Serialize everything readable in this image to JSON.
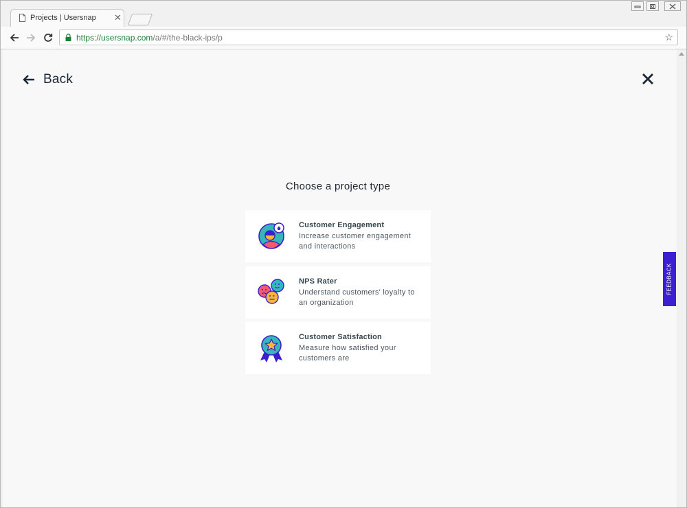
{
  "browser": {
    "tab_title": "Projects | Usersnap",
    "url_scheme": "https://",
    "url_host": "usersnap.com",
    "url_path": "/a/#/the-black-ips/p"
  },
  "page": {
    "back_label": "Back",
    "heading": "Choose a project type",
    "feedback_label": "FEEDBACK",
    "accent_color": "#3b1fd1"
  },
  "projects": [
    {
      "title": "Customer Engagement",
      "description": "Increase customer engagement and interactions",
      "icon": "customer-engagement-icon"
    },
    {
      "title": "NPS Rater",
      "description": "Understand customers' loyalty to an organization",
      "icon": "nps-rater-icon"
    },
    {
      "title": "Customer Satisfaction",
      "description": "Measure how satisfied your customers are",
      "icon": "customer-satisfaction-icon"
    }
  ]
}
